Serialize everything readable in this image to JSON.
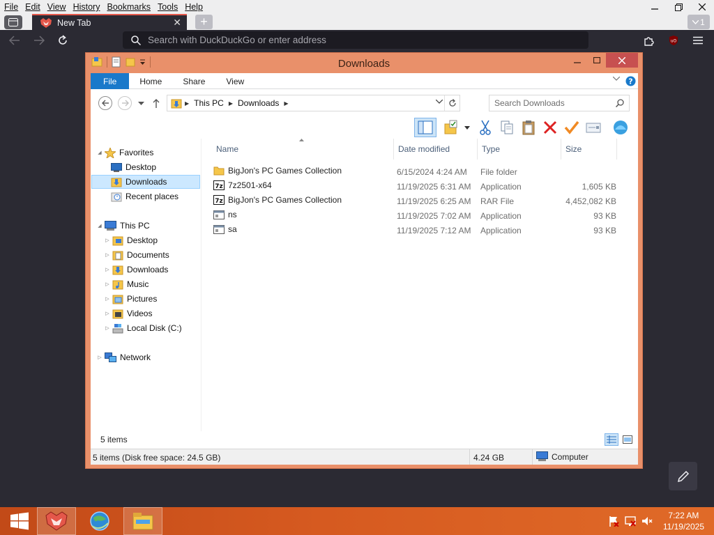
{
  "browser": {
    "menu": [
      "File",
      "Edit",
      "View",
      "History",
      "Bookmarks",
      "Tools",
      "Help"
    ],
    "tab": {
      "title": "New Tab",
      "close": "✕"
    },
    "new_tab": "+",
    "tab_list_count": "1",
    "url_placeholder": "Search with DuckDuckGo or enter address",
    "icons": [
      "tab-view-icon",
      "back-arrow-icon",
      "forward-arrow-icon",
      "reload-icon",
      "search-icon",
      "extensions-icon",
      "ublock-icon",
      "hamburger-menu-icon"
    ],
    "accent": "#e4574a"
  },
  "explorer": {
    "title": "Downloads",
    "ribbon_tabs": [
      "File",
      "Home",
      "Share",
      "View"
    ],
    "breadcrumb": [
      "This PC",
      "Downloads"
    ],
    "search_placeholder": "Search Downloads",
    "nav": {
      "favorites": "Favorites",
      "favorites_items": [
        "Desktop",
        "Downloads",
        "Recent places"
      ],
      "this_pc": "This PC",
      "this_pc_items": [
        "Desktop",
        "Documents",
        "Downloads",
        "Music",
        "Pictures",
        "Videos",
        "Local Disk (C:)"
      ],
      "network": "Network"
    },
    "columns": [
      "Name",
      "Date modified",
      "Type",
      "Size"
    ],
    "files": [
      {
        "name": "BigJon's PC Games Collection",
        "date": "6/15/2024 4:24 AM",
        "type": "File folder",
        "size": "",
        "icon": "folder-icon"
      },
      {
        "name": "7z2501-x64",
        "date": "11/19/2025 6:31 AM",
        "type": "Application",
        "size": "1,605 KB",
        "icon": "7zip-icon"
      },
      {
        "name": "BigJon's PC Games Collection",
        "date": "11/19/2025 6:25 AM",
        "type": "RAR File",
        "size": "4,452,082 KB",
        "icon": "7zip-icon"
      },
      {
        "name": "ns",
        "date": "11/19/2025 7:02 AM",
        "type": "Application",
        "size": "93 KB",
        "icon": "app-icon"
      },
      {
        "name": "sa",
        "date": "11/19/2025 7:12 AM",
        "type": "Application",
        "size": "93 KB",
        "icon": "app-icon"
      }
    ],
    "item_count": "5 items",
    "status": {
      "left": "5 items (Disk free space: 24.5 GB)",
      "size": "4.24 GB",
      "location": "Computer"
    },
    "window_color": "#e9906a",
    "selection_color": "#cce8ff"
  },
  "taskbar": {
    "time": "7:22 AM",
    "date": "11/19/2025",
    "color": "#d65a20"
  }
}
